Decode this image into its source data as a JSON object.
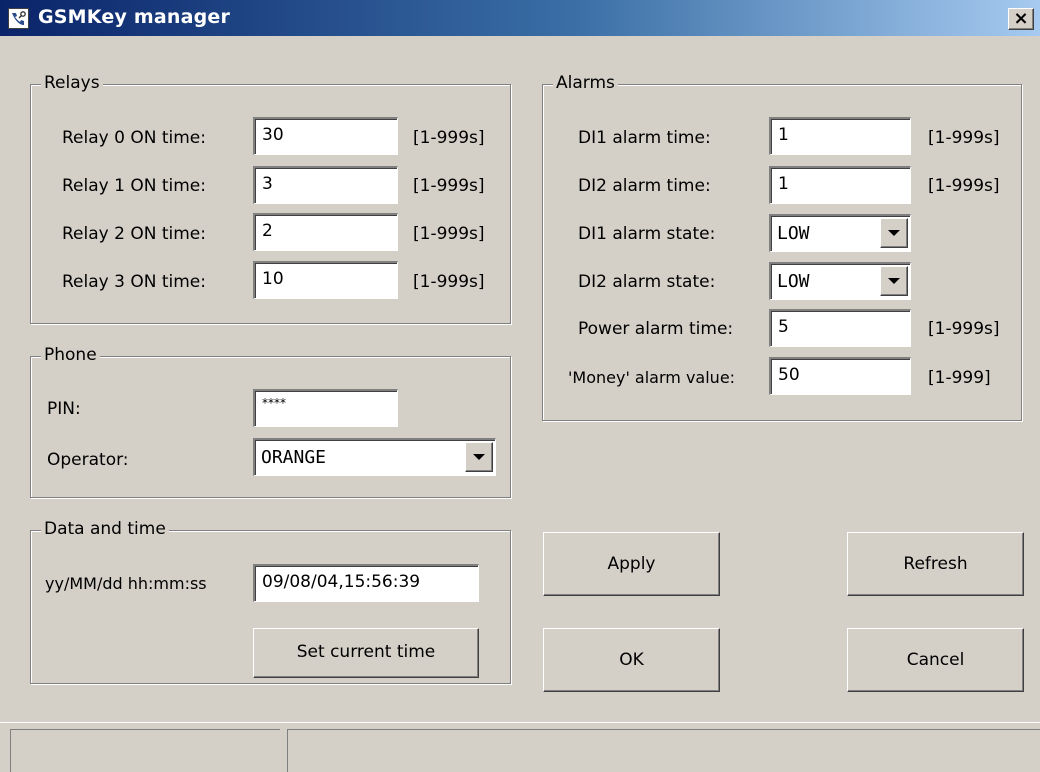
{
  "window": {
    "title": "GSMKey manager",
    "close_glyph": "×"
  },
  "relays": {
    "title": "Relays",
    "rows": [
      {
        "label": "Relay 0 ON time:",
        "value": "30",
        "range": "[1-999s]"
      },
      {
        "label": "Relay 1 ON time:",
        "value": "3",
        "range": "[1-999s]"
      },
      {
        "label": "Relay 2 ON time:",
        "value": "2",
        "range": "[1-999s]"
      },
      {
        "label": "Relay 3 ON time:",
        "value": "10",
        "range": "[1-999s]"
      }
    ]
  },
  "phone": {
    "title": "Phone",
    "pin_label": "PIN:",
    "pin_value": "****",
    "operator_label": "Operator:",
    "operator_value": "ORANGE"
  },
  "datetime": {
    "title": "Data and time",
    "format_label": "yy/MM/dd hh:mm:ss",
    "value": "09/08/04,15:56:39",
    "set_button": "Set current time"
  },
  "alarms": {
    "title": "Alarms",
    "di1_time": {
      "label": "DI1 alarm time:",
      "value": "1",
      "range": "[1-999s]"
    },
    "di2_time": {
      "label": "DI2 alarm time:",
      "value": "1",
      "range": "[1-999s]"
    },
    "di1_state": {
      "label": "DI1 alarm state:",
      "value": "LOW"
    },
    "di2_state": {
      "label": "DI2 alarm state:",
      "value": "LOW"
    },
    "power_time": {
      "label": "Power alarm time:",
      "value": "5",
      "range": "[1-999s]"
    },
    "money_value": {
      "label": "'Money' alarm value:",
      "value": "50",
      "range": "[1-999]"
    }
  },
  "buttons": {
    "apply": "Apply",
    "refresh": "Refresh",
    "ok": "OK",
    "cancel": "Cancel"
  },
  "icons": {
    "app": "phone-key-icon",
    "close": "close-icon",
    "dropdown": "dropdown-arrow-icon"
  }
}
